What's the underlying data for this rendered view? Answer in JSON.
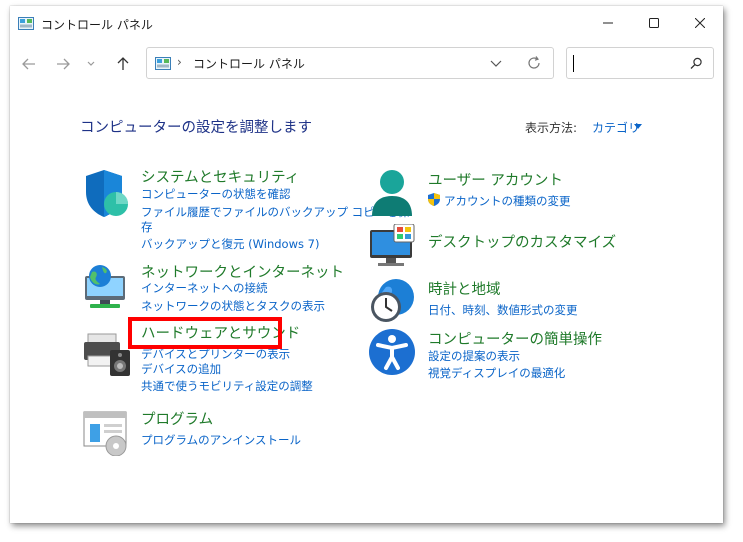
{
  "window": {
    "title": "コントロール パネル",
    "controls": {
      "minimize_icon": "minimize-icon",
      "maximize_icon": "maximize-icon",
      "close_icon": "close-icon"
    }
  },
  "nav": {
    "address": {
      "separator": "›",
      "location": "コントロール パネル"
    },
    "search": {
      "value": ""
    }
  },
  "main": {
    "heading": "コンピューターの設定を調整します",
    "view_by": {
      "label": "表示方法:",
      "value": "カテゴリ"
    }
  },
  "categories": {
    "system_security": {
      "title": "システムとセキュリティ",
      "links": [
        "コンピューターの状態を確認",
        "ファイル履歴でファイルのバックアップ コピーを保",
        "存",
        "バックアップと復元 (Windows 7)"
      ]
    },
    "network": {
      "title": "ネットワークとインターネット",
      "links": [
        "インターネットへの接続",
        "ネットワークの状態とタスクの表示"
      ]
    },
    "hardware_sound": {
      "title": "ハードウェアとサウンド",
      "links": [
        "デバイスとプリンターの表示",
        "デバイスの追加",
        "共通で使うモビリティ設定の調整"
      ]
    },
    "programs": {
      "title": "プログラム",
      "links": [
        "プログラムのアンインストール"
      ]
    },
    "user_accounts": {
      "title": "ユーザー アカウント",
      "links": [
        "アカウントの種類の変更"
      ]
    },
    "appearance": {
      "title": "デスクトップのカスタマイズ",
      "links": []
    },
    "clock_region": {
      "title": "時計と地域",
      "links": [
        "日付、時刻、数値形式の変更"
      ]
    },
    "ease_of_access": {
      "title": "コンピューターの簡単操作",
      "links": [
        "設定の提案の表示",
        "視覚ディスプレイの最適化"
      ]
    }
  },
  "annotation": {
    "highlight_color": "#ff0000"
  },
  "colors": {
    "link": "#0a64c8",
    "category_title": "#1f7a2a",
    "heading": "#1e3287"
  }
}
